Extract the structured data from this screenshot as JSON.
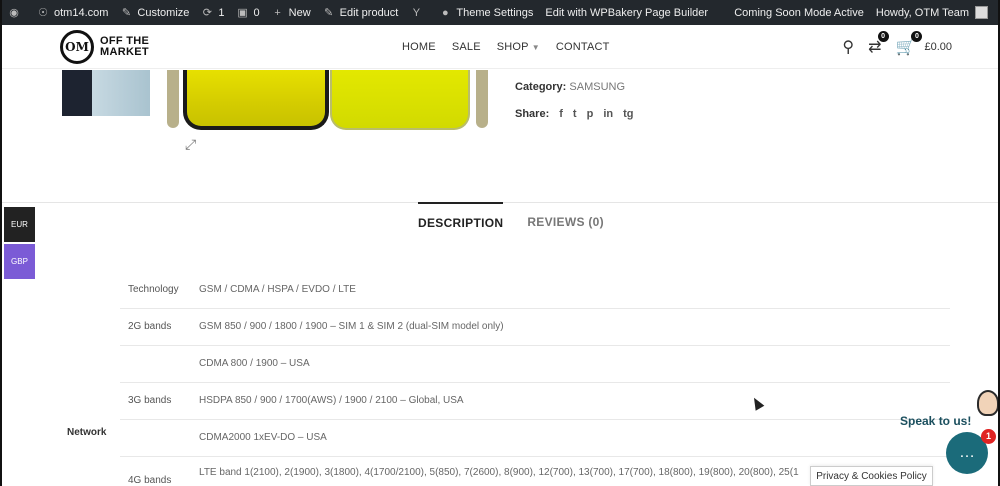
{
  "admin_bar": {
    "site": "otm14.com",
    "customize": "Customize",
    "updates_count": "1",
    "comments_count": "0",
    "new": "New",
    "edit_product": "Edit product",
    "theme_settings": "Theme Settings",
    "wpbakery": "Edit with WPBakery Page Builder",
    "coming_soon": "Coming Soon Mode Active",
    "howdy": "Howdy, OTM Team"
  },
  "header": {
    "logo_line1": "OFF THE",
    "logo_line2": "MARKET",
    "logo_mark": "OM",
    "nav": [
      "HOME",
      "SALE",
      "SHOP",
      "CONTACT"
    ],
    "compare_count": "0",
    "cart_count": "0",
    "cart_total": "£0.00"
  },
  "product": {
    "category_label": "Category:",
    "category_value": "SAMSUNG",
    "share_label": "Share:",
    "share_icons": [
      "f",
      "t",
      "p",
      "in",
      "tg"
    ]
  },
  "currency": {
    "eur": "EUR",
    "gbp": "GBP"
  },
  "tabs": {
    "description": "DESCRIPTION",
    "reviews": "REVIEWS (0)"
  },
  "specs": {
    "group": "Network",
    "rows": [
      {
        "key": "Technology",
        "value": "GSM / CDMA / HSPA / EVDO / LTE"
      },
      {
        "key": "2G bands",
        "value": "GSM 850 / 900 / 1800 / 1900 – SIM 1 & SIM 2 (dual-SIM model only)"
      },
      {
        "key": "",
        "value": "CDMA 800 / 1900 – USA"
      },
      {
        "key": "3G bands",
        "value": "HSDPA 850 / 900 / 1700(AWS) / 1900 / 2100 – Global, USA"
      },
      {
        "key": "",
        "value": "CDMA2000 1xEV-DO – USA"
      },
      {
        "key": "4G bands",
        "value": "LTE band 1(2100), 2(1900), 3(1800), 4(1700/2100), 5(850), 7(2600), 8(900), 12(700), 13(700), 17(700), 18(800), 19(800), 20(800), 25(1"
      }
    ]
  },
  "chat": {
    "speak": "Speak to us!",
    "badge": "1"
  },
  "privacy": "Privacy & Cookies Policy"
}
